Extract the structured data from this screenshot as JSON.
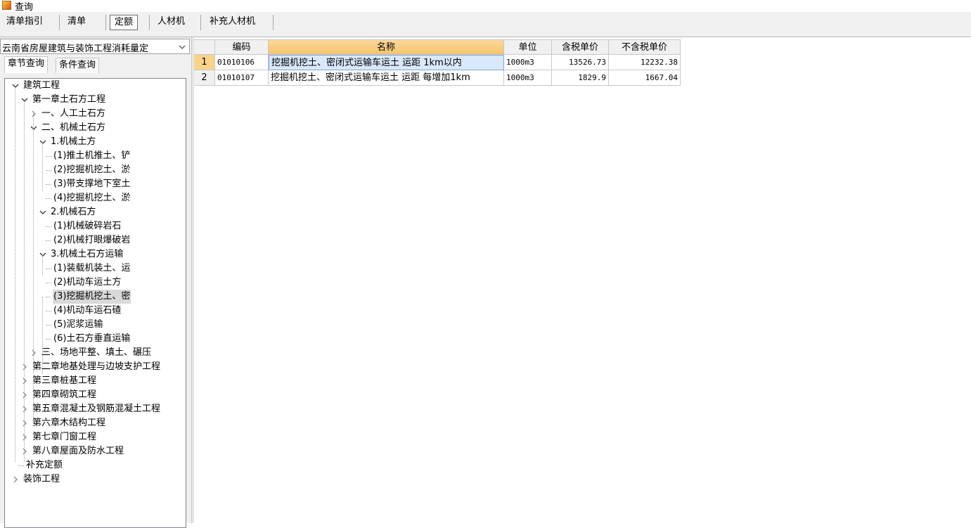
{
  "window": {
    "title": "查询"
  },
  "tabs": [
    {
      "label": "清单指引"
    },
    {
      "label": "清单"
    },
    {
      "label": "定额"
    },
    {
      "label": "人材机"
    },
    {
      "label": "补充人材机"
    }
  ],
  "left_panel": {
    "library_select": "云南省房屋建筑与装饰工程消耗量定",
    "subtabs": [
      {
        "label": "章节查询"
      },
      {
        "label": "条件查询"
      }
    ],
    "tree": [
      {
        "label": "建筑工程",
        "expanded": true
      },
      {
        "label": "第一章土石方工程",
        "expanded": true
      },
      {
        "label": "一、人工土石方",
        "expanded": false
      },
      {
        "label": "二、机械土石方",
        "expanded": true
      },
      {
        "label": "1.机械土方",
        "expanded": true
      },
      {
        "label": "(1)推土机推土、铲"
      },
      {
        "label": "(2)挖掘机挖土、淤"
      },
      {
        "label": "(3)带支撑地下室土"
      },
      {
        "label": "(4)挖掘机挖土、淤"
      },
      {
        "label": "2.机械石方",
        "expanded": true
      },
      {
        "label": "(1)机械破碎岩石"
      },
      {
        "label": "(2)机械打眼爆破岩"
      },
      {
        "label": "3.机械土石方运输",
        "expanded": true
      },
      {
        "label": "(1)装载机装土、运"
      },
      {
        "label": "(2)机动车运土方"
      },
      {
        "label": "(3)挖掘机挖土、密",
        "selected": true
      },
      {
        "label": "(4)机动车运石碴"
      },
      {
        "label": "(5)泥浆运输"
      },
      {
        "label": "(6)土石方垂直运输"
      },
      {
        "label": "三、场地平整、填土、碾压",
        "expanded": false
      },
      {
        "label": "第二章地基处理与边坡支护工程",
        "expanded": false
      },
      {
        "label": "第三章桩基工程",
        "expanded": false
      },
      {
        "label": "第四章砌筑工程",
        "expanded": false
      },
      {
        "label": "第五章混凝土及钢筋混凝土工程",
        "expanded": false
      },
      {
        "label": "第六章木结构工程",
        "expanded": false
      },
      {
        "label": "第七章门窗工程",
        "expanded": false
      },
      {
        "label": "第八章屋面及防水工程",
        "expanded": false
      },
      {
        "label": "补充定额"
      },
      {
        "label": "装饰工程",
        "expanded": false
      }
    ]
  },
  "grid": {
    "columns": [
      "编码",
      "名称",
      "单位",
      "含税单价",
      "不含税单价"
    ],
    "rows": [
      {
        "index": "1",
        "code": "01010106",
        "name": "挖掘机挖土、密闭式运输车运土 运距 1km以内",
        "unit": "1000m3",
        "tax_price": "13526.73",
        "notax_price": "12232.38"
      },
      {
        "index": "2",
        "code": "01010107",
        "name": "挖掘机挖土、密闭式运输车运土 运距 每增加1km",
        "unit": "1000m3",
        "tax_price": "1829.9",
        "notax_price": "1667.04"
      }
    ]
  }
}
